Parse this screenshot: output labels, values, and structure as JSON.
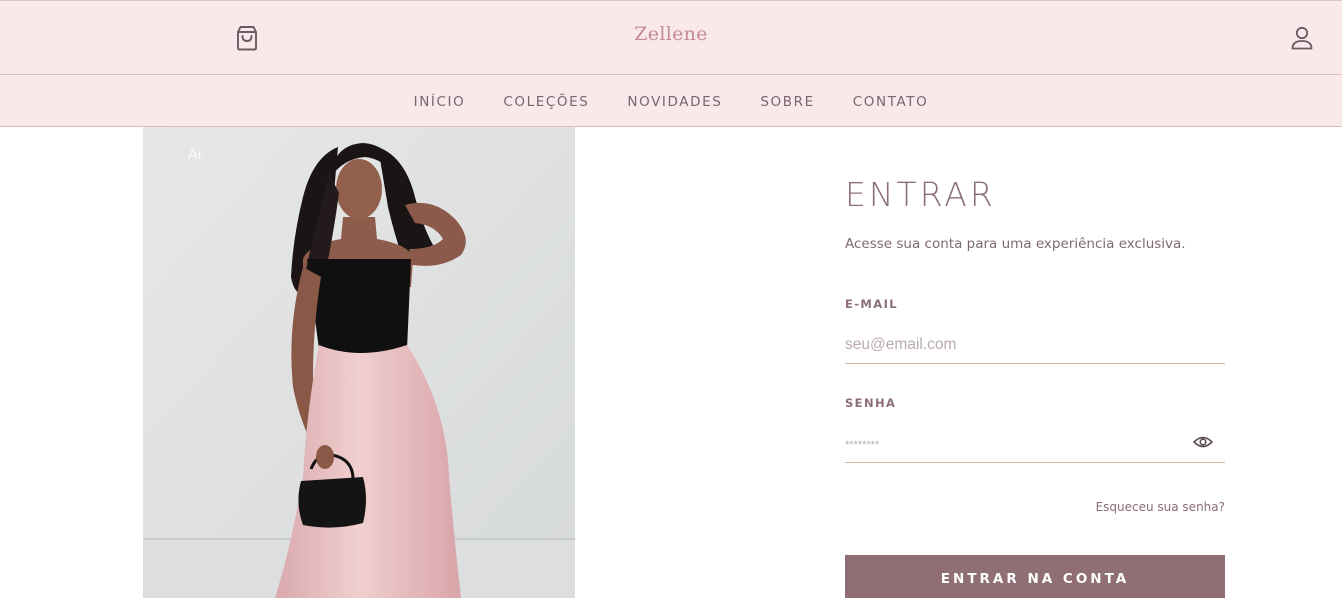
{
  "header": {
    "brand": "Zellene",
    "cart_icon": "shopping-bag-icon",
    "user_icon": "user-icon"
  },
  "nav": {
    "items": [
      {
        "label": "INÍCIO"
      },
      {
        "label": "COLEÇÕES"
      },
      {
        "label": "NOVIDADES"
      },
      {
        "label": "SOBRE"
      },
      {
        "label": "CONTATO"
      }
    ]
  },
  "hero": {
    "watermark": "Ai"
  },
  "login": {
    "title": "ENTRAR",
    "subtitle": "Acesse sua conta para uma experiência exclusiva.",
    "email_label": "E-MAIL",
    "email_value": "",
    "email_placeholder": "seu@email.com",
    "password_label": "SENHA",
    "password_value": "",
    "password_placeholder": "********",
    "password_toggle_icon": "eye-icon",
    "forgot_label": "Esqueceu sua senha?",
    "submit_label": "ENTRAR NA CONTA"
  },
  "colors": {
    "header_bg": "#f9e9ea",
    "brand": "#c4899b",
    "nav_text": "#7b6470",
    "title": "#8e6f76",
    "button_bg": "#8f6e74",
    "field_border": "#d4b7a9"
  }
}
